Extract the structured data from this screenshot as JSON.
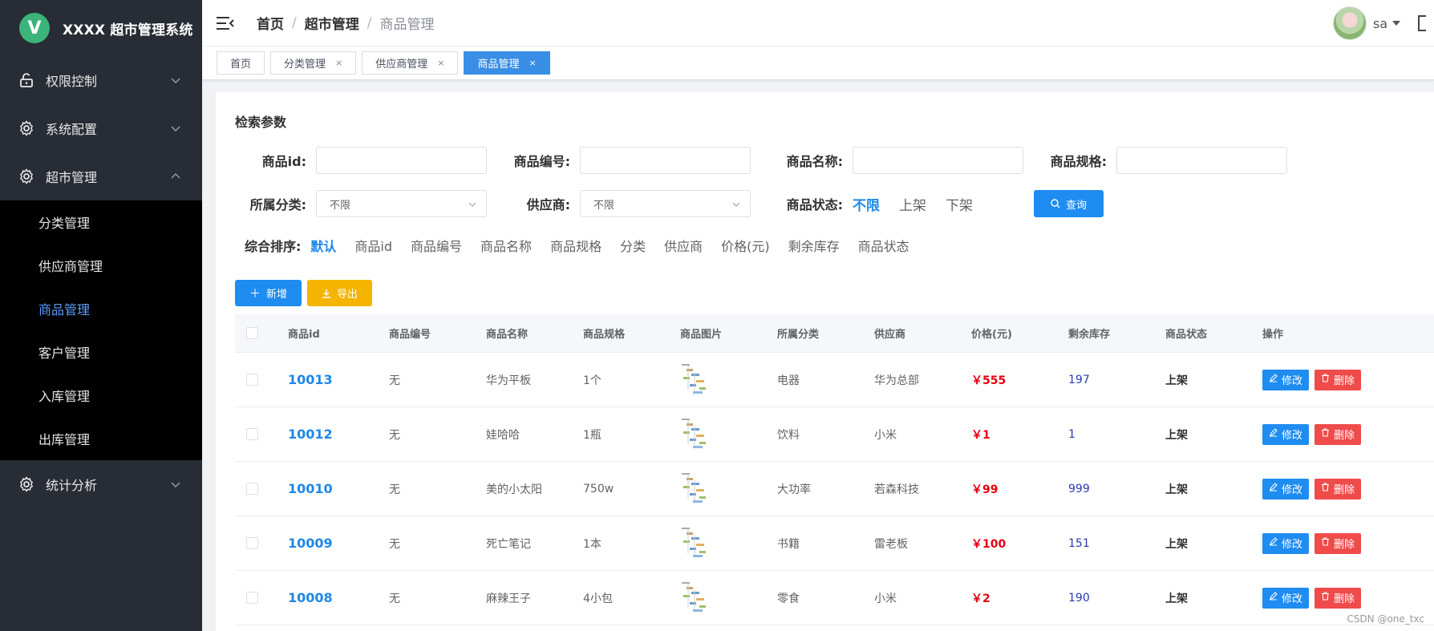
{
  "app": {
    "logo_letter": "V",
    "title": "XXXX 超市管理系统"
  },
  "sidebar": {
    "groups": [
      {
        "label": "权限控制",
        "icon": "lock-icon"
      },
      {
        "label": "系统配置",
        "icon": "gear-icon"
      },
      {
        "label": "超市管理",
        "icon": "gear-icon"
      },
      {
        "label": "统计分析",
        "icon": "gear-icon"
      }
    ],
    "sub_items": [
      {
        "label": "分类管理"
      },
      {
        "label": "供应商管理"
      },
      {
        "label": "商品管理",
        "active": true
      },
      {
        "label": "客户管理"
      },
      {
        "label": "入库管理"
      },
      {
        "label": "出库管理"
      }
    ]
  },
  "header": {
    "breadcrumb": [
      "首页",
      "超市管理",
      "商品管理"
    ],
    "separator": "/",
    "username": "sa"
  },
  "tags": [
    {
      "label": "首页",
      "closable": false
    },
    {
      "label": "分类管理",
      "closable": true
    },
    {
      "label": "供应商管理",
      "closable": true
    },
    {
      "label": "商品管理",
      "closable": true,
      "active": true
    }
  ],
  "close_glyph": "×",
  "search": {
    "title": "检索参数",
    "fields": {
      "goods_id_label": "商品id:",
      "goods_code_label": "商品编号:",
      "goods_name_label": "商品名称:",
      "goods_spec_label": "商品规格:",
      "category_label": "所属分类:",
      "category_value": "不限",
      "supplier_label": "供应商:",
      "supplier_value": "不限",
      "status_label": "商品状态:"
    },
    "status_options": [
      "不限",
      "上架",
      "下架"
    ],
    "query_button": "查询"
  },
  "sort": {
    "label": "综合排序:",
    "options": [
      "默认",
      "商品id",
      "商品编号",
      "商品名称",
      "商品规格",
      "分类",
      "供应商",
      "价格(元)",
      "剩余库存",
      "商品状态"
    ]
  },
  "toolbar": {
    "add_label": "新增",
    "export_label": "导出"
  },
  "table": {
    "columns": [
      "商品id",
      "商品编号",
      "商品名称",
      "商品规格",
      "商品图片",
      "所属分类",
      "供应商",
      "价格(元)",
      "剩余库存",
      "商品状态",
      "操作"
    ],
    "rows": [
      {
        "id": "10013",
        "code": "无",
        "name": "华为平板",
        "spec": "1个",
        "category": "电器",
        "supplier": "华为总部",
        "price": "￥555",
        "stock": "197",
        "status": "上架"
      },
      {
        "id": "10012",
        "code": "无",
        "name": "娃哈哈",
        "spec": "1瓶",
        "category": "饮料",
        "supplier": "小米",
        "price": "￥1",
        "stock": "1",
        "status": "上架"
      },
      {
        "id": "10010",
        "code": "无",
        "name": "美的小太阳",
        "spec": "750w",
        "category": "大功率",
        "supplier": "若森科技",
        "price": "￥99",
        "stock": "999",
        "status": "上架"
      },
      {
        "id": "10009",
        "code": "无",
        "name": "死亡笔记",
        "spec": "1本",
        "category": "书籍",
        "supplier": "雷老板",
        "price": "￥100",
        "stock": "151",
        "status": "上架"
      },
      {
        "id": "10008",
        "code": "无",
        "name": "麻辣王子",
        "spec": "4小包",
        "category": "零食",
        "supplier": "小米",
        "price": "￥2",
        "stock": "190",
        "status": "上架"
      }
    ],
    "edit_label": "修改",
    "delete_label": "删除"
  },
  "watermark": "CSDN @one_txc",
  "colors": {
    "sidebar_bg": "#282c34",
    "submenu_bg": "#000000",
    "active_text": "#5c9cff",
    "primary": "#1e8cf0",
    "warning": "#f5b400",
    "danger": "#f04b4b",
    "price": "#e60012"
  }
}
